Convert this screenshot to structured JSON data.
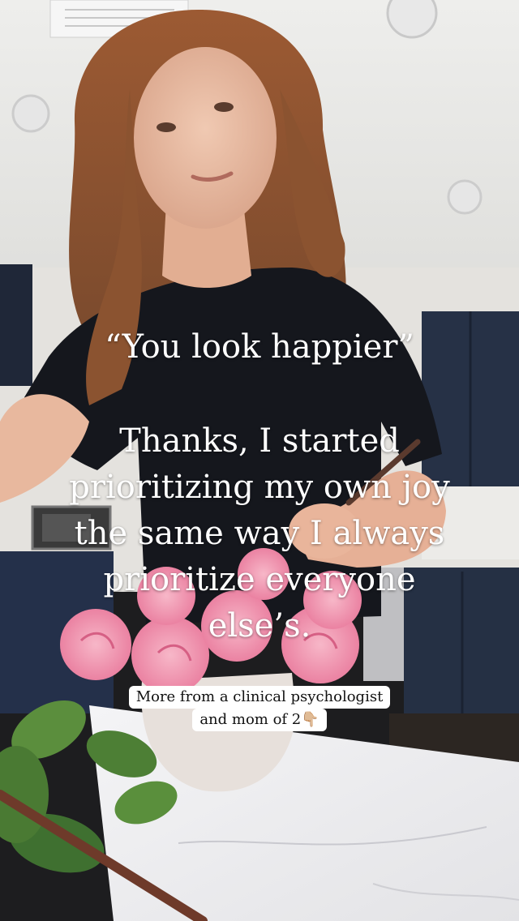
{
  "overlay": {
    "quote": "“You look happier”",
    "response": "Thanks, I started prioritizing my own joy the same way I always prioritize everyone else’s."
  },
  "caption": {
    "line1": "More from a clinical psychologist",
    "line2": "and mom of 2👇🏼"
  }
}
